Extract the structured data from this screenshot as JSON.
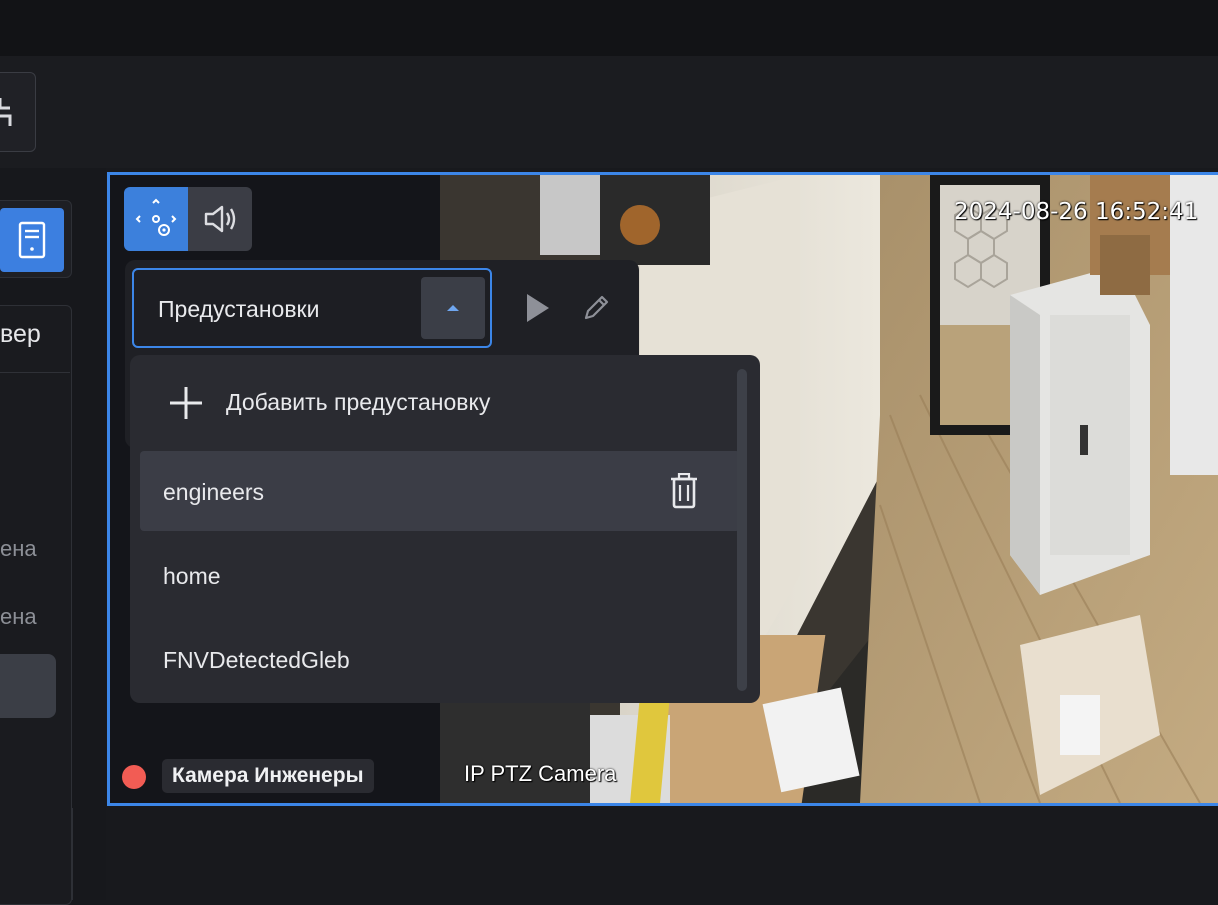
{
  "sidebar": {
    "header_partial": "вер",
    "items": [
      {
        "label": "ена"
      },
      {
        "label": "ена"
      }
    ]
  },
  "viewer": {
    "timestamp": "2024-08-26 16:52:41",
    "camera_label": "IP PTZ Camera",
    "camera_name": "Камера Инженеры",
    "controls": {
      "ptz_icon": "ptz-control-icon",
      "sound_icon": "speaker-icon"
    }
  },
  "presets": {
    "select_label": "Предустановки",
    "add_label": "Добавить предустановку",
    "items": [
      {
        "label": "engineers"
      },
      {
        "label": "home"
      },
      {
        "label": "FNVDetectedGleb"
      }
    ]
  },
  "colors": {
    "accent": "#3c86e8",
    "record": "#f25c54",
    "panel": "#1f2025",
    "dropdown": "#2a2b31"
  }
}
